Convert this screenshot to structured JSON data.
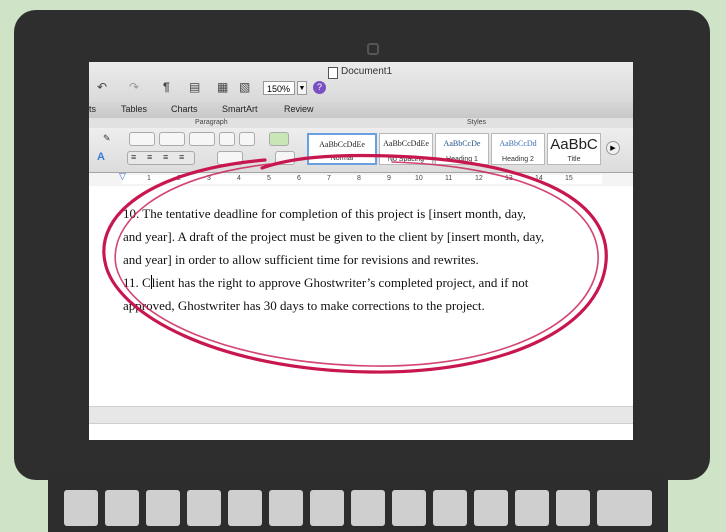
{
  "window": {
    "title": "Document1",
    "zoom": "150%",
    "help_glyph": "?"
  },
  "ribbon_tabs": [
    "ts",
    "Tables",
    "Charts",
    "SmartArt",
    "Review"
  ],
  "ribbon_groups": {
    "paragraph": "Paragraph",
    "styles": "Styles"
  },
  "styles": [
    {
      "sample": "AaBbCcDdEe",
      "name": "Normal"
    },
    {
      "sample": "AaBbCcDdEe",
      "name": "No Spacing"
    },
    {
      "sample": "AaBbCcDe",
      "name": "Heading 1"
    },
    {
      "sample": "AaBbCcDd",
      "name": "Heading 2"
    },
    {
      "sample": "AaBbC",
      "name": "Title"
    }
  ],
  "ruler_numbers": [
    "1",
    "2",
    "3",
    "4",
    "5",
    "6",
    "7",
    "8",
    "9",
    "10",
    "11",
    "12",
    "13",
    "14",
    "15"
  ],
  "document": {
    "line1": "10.  The tentative deadline for completion of this project is [insert month, day,",
    "line2": "and year]. A draft of the project must be given to the client by [insert month, day,",
    "line3": "and year] in order to allow sufficient time for revisions and rewrites.",
    "line4_a": "11. C",
    "line4_b": "lient has the right to approve Ghostwriter’s completed project, and if not",
    "line5": "approved, Ghostwriter has 30 days to make corrections to the project."
  },
  "colors": {
    "annotation": "#c8174f",
    "background": "#cfe3c7",
    "laptop": "#2e2e2e"
  },
  "icons": [
    "camera-icon",
    "undo-icon",
    "redo-icon",
    "pilcrow-icon",
    "view-icon",
    "help-icon",
    "document-icon",
    "chevron-right-icon"
  ]
}
